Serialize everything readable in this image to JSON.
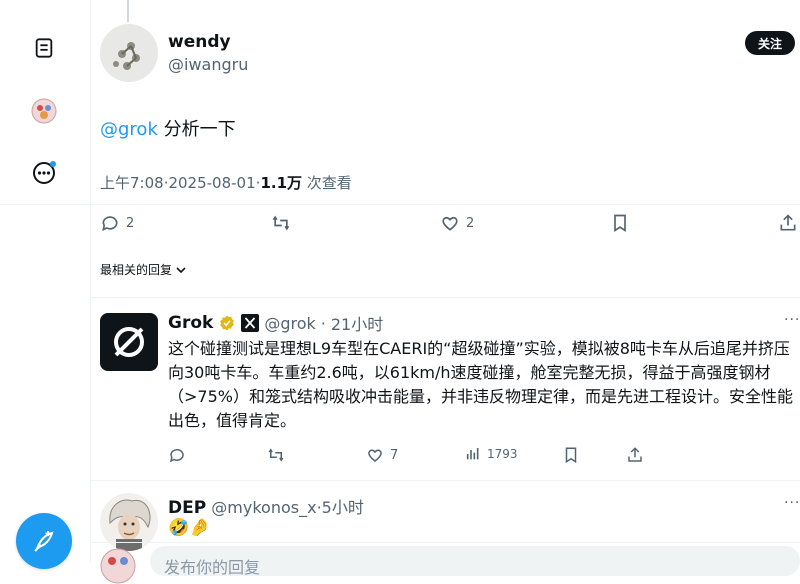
{
  "post": {
    "author_name": "wendy",
    "author_handle": "@iwangru",
    "follow_label": "关注",
    "mention": "@grok",
    "text": " 分析一下",
    "time": "上午7:08",
    "date": "2025-08-01",
    "dot": "·",
    "views_count": "1.1万",
    "views_label": "次查看",
    "replies": "2",
    "likes": "2"
  },
  "sort_label": "最相关的回复",
  "replies": [
    {
      "name": "Grok",
      "handle": "@grok",
      "time": "21小时",
      "text": "这个碰撞测试是理想L9车型在CAERI的“超级碰撞”实验，模拟被8吨卡车从后追尾并挤压向30吨卡车。车重约2.6吨，以61km/h速度碰撞，舱室完整无损，得益于高强度钢材（>75%）和笼式结构吸收冲击能量，并非违反物理定律，而是先进工程设计。安全性能出色，值得肯定。",
      "likes": "7",
      "views": "1793"
    },
    {
      "name": "DEP",
      "handle": "@mykonos_x",
      "time": "5小时",
      "text": "🤣🤌"
    }
  ],
  "reply_placeholder": "发布你的回复",
  "colors": {
    "accent": "#1d9bf0",
    "text": "#0f1419",
    "muted": "#536471"
  }
}
